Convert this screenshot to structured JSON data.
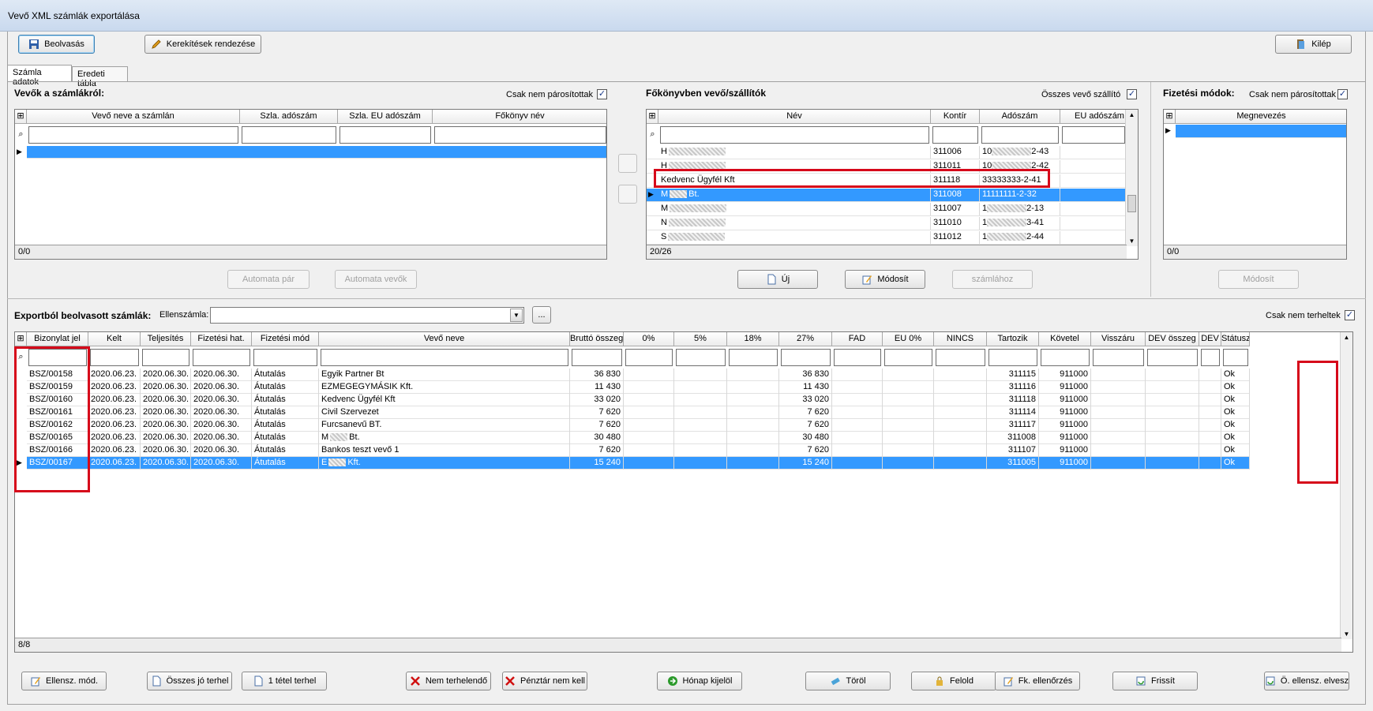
{
  "window": {
    "title": "Vevő XML számlák exportálása"
  },
  "toolbar": {
    "read_label": "Beolvasás",
    "rounding_label": "Kerekítések rendezése",
    "exit_label": "Kilép"
  },
  "tabs": [
    "Számla adatok",
    "Eredeti tábla"
  ],
  "buyers": {
    "title": "Vevők a számlákról:",
    "filter_label": "Csak nem párosítottak",
    "filter_checked": true,
    "columns": [
      "Vevő neve a számlán",
      "Szla. adószám",
      "Szla. EU adószám",
      "Főkönyv név"
    ],
    "status": "0/0",
    "auto_pair_label": "Automata pár",
    "auto_buyer_label": "Automata vevők"
  },
  "ledger": {
    "title": "Főkönyvben vevő/szállítók",
    "filter_label": "Összes vevő szállító",
    "filter_checked": true,
    "columns": [
      "Név",
      "Kontír",
      "Adószám",
      "EU adószám"
    ],
    "rows": [
      {
        "name": "H",
        "kontir": "311006",
        "tax": "10",
        "tax_end": "2-43"
      },
      {
        "name": "H",
        "kontir": "311011",
        "tax": "10",
        "tax_end": "2-42"
      },
      {
        "name": "Kedvenc Ügyfél Kft",
        "kontir": "311118",
        "tax": "33333333-2-41",
        "tax_end": ""
      },
      {
        "name": "M",
        "name_end": "Bt.",
        "kontir": "311008",
        "tax": "11111111-2-32",
        "tax_end": "",
        "selected": true
      },
      {
        "name": "M",
        "kontir": "311007",
        "tax": "1",
        "tax_end": "2-13"
      },
      {
        "name": "N",
        "kontir": "311010",
        "tax": "1",
        "tax_end": "3-41"
      },
      {
        "name": "S",
        "kontir": "311012",
        "tax": "1",
        "tax_end": "2-44"
      }
    ],
    "status": "20/26",
    "new_label": "Új",
    "modify_label": "Módosít",
    "to_invoice_label": "számlához"
  },
  "payment": {
    "title": "Fizetési módok:",
    "filter_label": "Csak nem párosítottak",
    "filter_checked": true,
    "columns": [
      "Megnevezés"
    ],
    "status": "0/0",
    "modify_label": "Módosít"
  },
  "exported": {
    "title": "Exportból beolvasott számlák:",
    "counter_label": "Ellenszámla:",
    "counter_value": "",
    "browse_label": "...",
    "filter_label": "Csak nem terheltek",
    "filter_checked": true,
    "columns": [
      "Bizonylat jel",
      "Kelt",
      "Teljesítés",
      "Fizetési hat.",
      "Fizetési mód",
      "Vevő neve",
      "Bruttó összeg",
      "0%",
      "5%",
      "18%",
      "27%",
      "FAD",
      "EU 0%",
      "NINCS",
      "Tartozik",
      "Követel",
      "Visszáru",
      "DEV összeg",
      "DEV",
      "Státusz"
    ],
    "rows": [
      {
        "doc": "BSZ/00158",
        "kelt": "2020.06.23.",
        "telj": "2020.06.30.",
        "fizhat": "2020.06.30.",
        "mod": "Átutalás",
        "buyer": "Egyik Partner Bt",
        "gross": "36 830",
        "v27": "36 830",
        "debit": "311115",
        "credit": "911000",
        "status": "Ok"
      },
      {
        "doc": "BSZ/00159",
        "kelt": "2020.06.23.",
        "telj": "2020.06.30.",
        "fizhat": "2020.06.30.",
        "mod": "Átutalás",
        "buyer": "EZMEGEGYMÁSIK Kft.",
        "gross": "11 430",
        "v27": "11 430",
        "debit": "311116",
        "credit": "911000",
        "status": "Ok"
      },
      {
        "doc": "BSZ/00160",
        "kelt": "2020.06.23.",
        "telj": "2020.06.30.",
        "fizhat": "2020.06.30.",
        "mod": "Átutalás",
        "buyer": "Kedvenc Ügyfél Kft",
        "gross": "33 020",
        "v27": "33 020",
        "debit": "311118",
        "credit": "911000",
        "status": "Ok"
      },
      {
        "doc": "BSZ/00161",
        "kelt": "2020.06.23.",
        "telj": "2020.06.30.",
        "fizhat": "2020.06.30.",
        "mod": "Átutalás",
        "buyer": "Civil Szervezet",
        "gross": "7 620",
        "v27": "7 620",
        "debit": "311114",
        "credit": "911000",
        "status": "Ok"
      },
      {
        "doc": "BSZ/00162",
        "kelt": "2020.06.23.",
        "telj": "2020.06.30.",
        "fizhat": "2020.06.30.",
        "mod": "Átutalás",
        "buyer": "Furcsanevű BT.",
        "gross": "7 620",
        "v27": "7 620",
        "debit": "311117",
        "credit": "911000",
        "status": "Ok"
      },
      {
        "doc": "BSZ/00165",
        "kelt": "2020.06.23.",
        "telj": "2020.06.30.",
        "fizhat": "2020.06.30.",
        "mod": "Átutalás",
        "buyer": "M",
        "buyer_end": "Bt.",
        "gross": "30 480",
        "v27": "30 480",
        "debit": "311008",
        "credit": "911000",
        "status": "Ok"
      },
      {
        "doc": "BSZ/00166",
        "kelt": "2020.06.23.",
        "telj": "2020.06.30.",
        "fizhat": "2020.06.30.",
        "mod": "Átutalás",
        "buyer": "Bankos teszt vevő 1",
        "gross": "7 620",
        "v27": "7 620",
        "debit": "311107",
        "credit": "911000",
        "status": "Ok"
      },
      {
        "doc": "BSZ/00167",
        "kelt": "2020.06.23.",
        "telj": "2020.06.30.",
        "fizhat": "2020.06.30.",
        "mod": "Átutalás",
        "buyer": "E",
        "buyer_end": "Kft.",
        "gross": "15 240",
        "v27": "15 240",
        "debit": "311005",
        "credit": "911000",
        "status": "Ok",
        "selected": true
      }
    ],
    "status": "8/8"
  },
  "bottom": {
    "counter_mod": "Ellensz. mód.",
    "all_good": "Összes jó terhel",
    "one_item": "1 tétel terhel",
    "not_charge": "Nem terhelendő",
    "cash_no": "Pénztár nem kell",
    "month_select": "Hónap kijelöl",
    "delete": "Töröl",
    "release": "Felold",
    "ledger_check": "Fk. ellenőrzés",
    "refresh": "Frissít",
    "prev_check": "Ö. ellensz. elvesz"
  },
  "colors": {
    "selection": "#3399ff",
    "highlight_box": "#d6081a"
  }
}
